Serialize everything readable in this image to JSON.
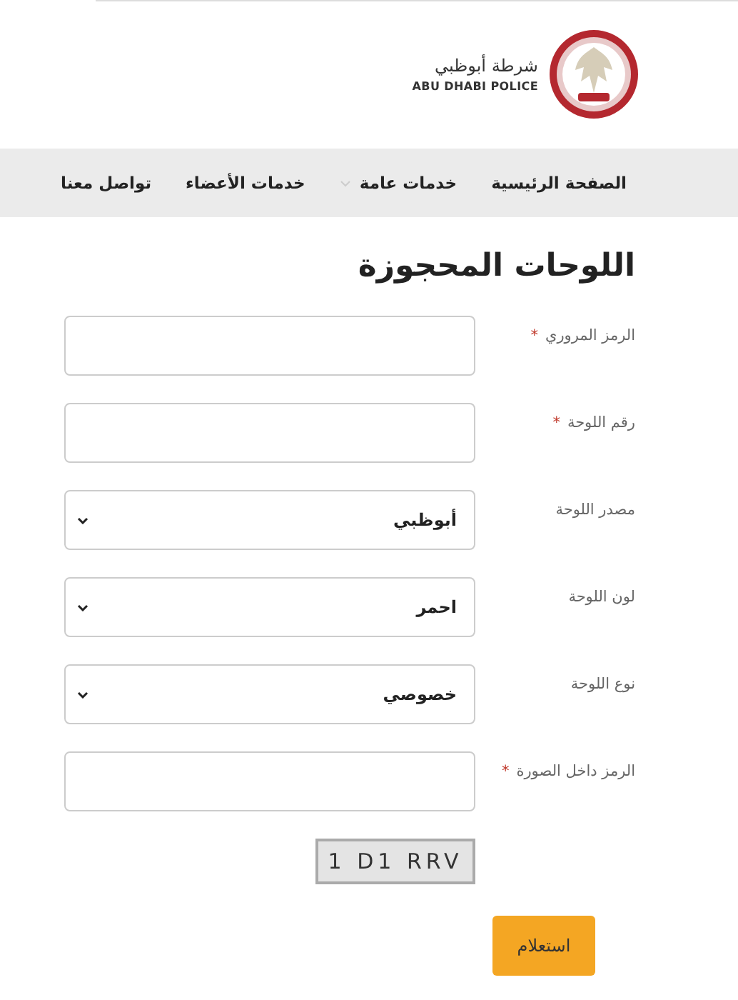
{
  "header": {
    "logo_arabic": "شرطة أبوظبي",
    "logo_english": "ABU DHABI POLICE"
  },
  "nav": [
    {
      "label": "الصفحة الرئيسية",
      "has_dropdown": false
    },
    {
      "label": "خدمات عامة",
      "has_dropdown": true
    },
    {
      "label": "خدمات الأعضاء",
      "has_dropdown": false
    },
    {
      "label": "تواصل معنا",
      "has_dropdown": false
    }
  ],
  "title": "اللوحات المحجوزة",
  "fields": [
    {
      "kind": "text",
      "label": "الرمز المروري",
      "required_mark": "*"
    },
    {
      "kind": "text",
      "label": "رقم اللوحة",
      "required_mark": "*"
    },
    {
      "kind": "select",
      "label": "مصدر اللوحة",
      "value": "أبوظبي"
    },
    {
      "kind": "select",
      "label": "لون اللوحة",
      "value": "احمر"
    },
    {
      "kind": "select",
      "label": "نوع اللوحة",
      "value": "خصوصي"
    },
    {
      "kind": "text",
      "label": "الرمز داخل الصورة",
      "required_mark": "*"
    }
  ],
  "captcha": "1 D1 RRV",
  "submit": "استعلام"
}
